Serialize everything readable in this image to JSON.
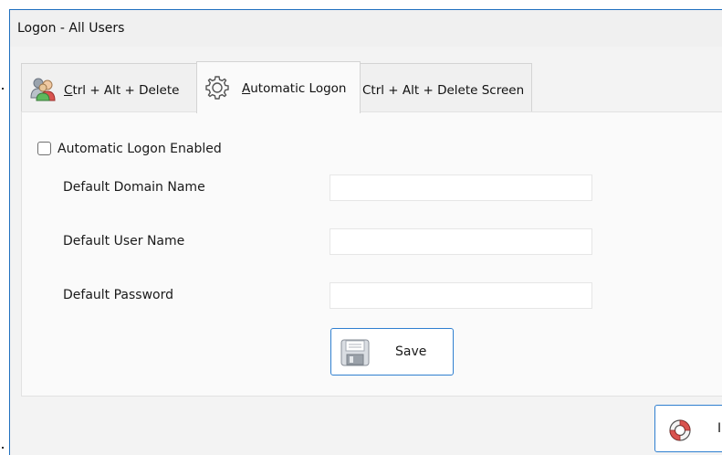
{
  "window": {
    "title": "Logon - All Users"
  },
  "tabs": [
    {
      "prefix": "C",
      "label": "trl + Alt + Delete",
      "icon": "users-icon"
    },
    {
      "prefix": "A",
      "label": "utomatic Logon",
      "icon": "gear-icon",
      "active": true
    },
    {
      "label": "Ctrl + Alt + Delete Screen"
    }
  ],
  "form": {
    "checkbox_label": "Automatic Logon Enabled",
    "checkbox_checked": false,
    "domain_label": "Default Domain Name",
    "domain_value": "",
    "user_label": "Default User Name",
    "user_value": "",
    "password_label": "Default Password",
    "password_value": "",
    "save_label": "Save",
    "save_icon": "floppy-disk-icon"
  },
  "footer": {
    "help_label": "I",
    "help_icon": "lifebuoy-icon"
  },
  "colors": {
    "accent": "#1f6fbf",
    "button_border": "#2f7fd0"
  }
}
